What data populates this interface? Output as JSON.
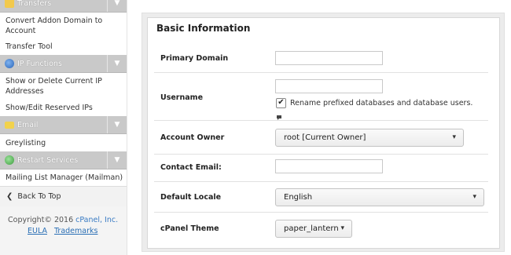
{
  "sidebar": {
    "sections": [
      {
        "label": "Transfers",
        "icon": "transfers-icon",
        "icon_color": "#f2c94c"
      },
      {
        "label": "IP Functions",
        "icon": "globe-icon",
        "icon_color": "#3a7bd5"
      },
      {
        "label": "Email",
        "icon": "envelope-icon",
        "icon_color": "#f2d24c"
      },
      {
        "label": "Restart Services",
        "icon": "restart-icon",
        "icon_color": "#5cb85c"
      }
    ],
    "links": [
      "Convert Addon Domain to Account",
      "Transfer Tool",
      "Show or Delete Current IP Addresses",
      "Show/Edit Reserved IPs",
      "Greylisting",
      "Mailing List Manager (Mailman)"
    ],
    "back_to_top": "Back To Top",
    "copyright_prefix": "Copyright© 2016 ",
    "copyright_brand": "cPanel, Inc.",
    "eula": "EULA",
    "trademarks": "Trademarks"
  },
  "form": {
    "title": "Basic Information",
    "primary_domain": {
      "label": "Primary Domain",
      "value": ""
    },
    "username": {
      "label": "Username",
      "value": ""
    },
    "rename_checkbox": {
      "label": "Rename prefixed databases and database users.",
      "checked": true
    },
    "account_owner": {
      "label": "Account Owner",
      "value": "root [Current Owner]"
    },
    "contact_email": {
      "label": "Contact Email:",
      "value": ""
    },
    "default_locale": {
      "label": "Default Locale",
      "value": "English"
    },
    "cpanel_theme": {
      "label": "cPanel Theme",
      "value": "paper_lantern"
    }
  },
  "colors": {
    "link": "#2a6fb5",
    "section_header": "#c9c9c9",
    "panel_bg": "#ececec"
  }
}
